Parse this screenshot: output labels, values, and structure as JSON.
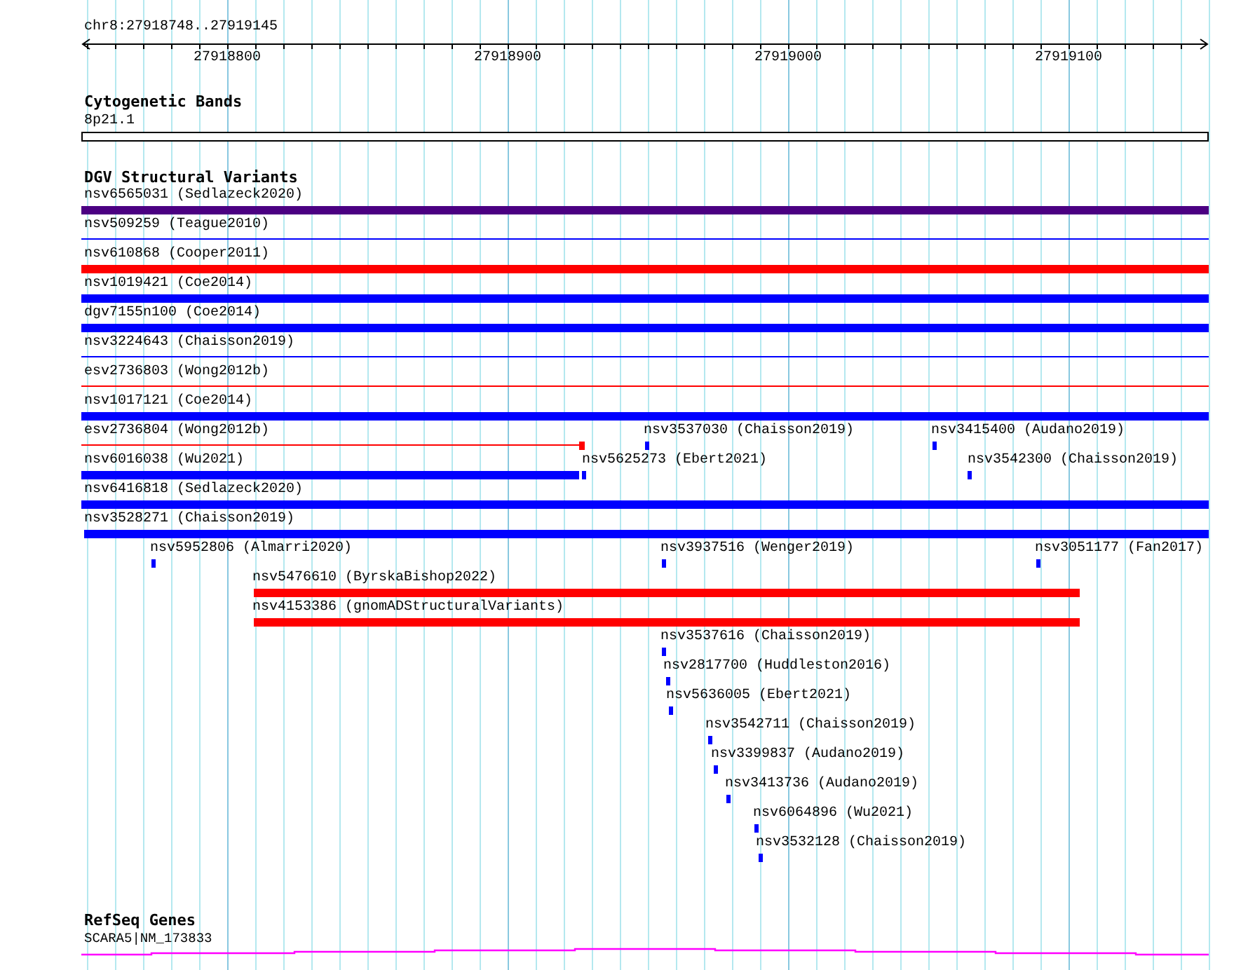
{
  "ruler": {
    "label": "chr8:27918748..27919145",
    "ticks": [
      "27918800",
      "27918900",
      "27919000",
      "27919100"
    ]
  },
  "cytogenetic_bands": {
    "title": "Cytogenetic Bands",
    "band": "8p21.1"
  },
  "dgv_structural_variants": {
    "title": "DGV Structural Variants",
    "features": [
      {
        "label": "nsv6565031 (Sedlazeck2020)",
        "color": "#4b0082",
        "kind": "thick"
      },
      {
        "label": "nsv509259 (Teague2010)",
        "color": "#0000ff",
        "kind": "thin"
      },
      {
        "label": "nsv610868 (Cooper2011)",
        "color": "#ff0000",
        "kind": "thick"
      },
      {
        "label": "nsv1019421 (Coe2014)",
        "color": "#0000ff",
        "kind": "thick"
      },
      {
        "label": "dgv7155n100 (Coe2014)",
        "color": "#0000ff",
        "kind": "thick"
      },
      {
        "label": "nsv3224643 (Chaisson2019)",
        "color": "#0000ff",
        "kind": "thin"
      },
      {
        "label": "esv2736803 (Wong2012b)",
        "color": "#ff0000",
        "kind": "thin"
      },
      {
        "label": "nsv1017121 (Coe2014)",
        "color": "#0000ff",
        "kind": "thick"
      },
      {
        "label": "esv2736804 (Wong2012b)",
        "color": "#ff0000",
        "kind": "capped"
      },
      {
        "label": "nsv3537030 (Chaisson2019)",
        "color": "#0000ff",
        "kind": "thick"
      },
      {
        "label": "nsv3415400 (Audano2019)",
        "color": "#0000ff",
        "kind": "thick"
      },
      {
        "label": "nsv6016038 (Wu2021)",
        "color": "#0000ff",
        "kind": "thick"
      },
      {
        "label": "nsv5625273 (Ebert2021)",
        "color": "#0000ff",
        "kind": "thick"
      },
      {
        "label": "nsv3542300 (Chaisson2019)",
        "color": "#0000ff",
        "kind": "thick"
      },
      {
        "label": "nsv6416818 (Sedlazeck2020)",
        "color": "#0000ff",
        "kind": "thick"
      },
      {
        "label": "nsv3528271 (Chaisson2019)",
        "color": "#0000ff",
        "kind": "thick"
      },
      {
        "label": "nsv5952806 (Almarri2020)",
        "color": "#0000ff",
        "kind": "thick"
      },
      {
        "label": "nsv3937516 (Wenger2019)",
        "color": "#0000ff",
        "kind": "thick"
      },
      {
        "label": "nsv3051177 (Fan2017)",
        "color": "#0000ff",
        "kind": "thick"
      },
      {
        "label": "nsv5476610 (ByrskaBishop2022)",
        "color": "#ff0000",
        "kind": "thick"
      },
      {
        "label": "nsv4153386 (gnomADStructuralVariants)",
        "color": "#ff0000",
        "kind": "thick"
      },
      {
        "label": "nsv3537616 (Chaisson2019)",
        "color": "#0000ff",
        "kind": "thick"
      },
      {
        "label": "nsv2817700 (Huddleston2016)",
        "color": "#0000ff",
        "kind": "thick"
      },
      {
        "label": "nsv5636005 (Ebert2021)",
        "color": "#0000ff",
        "kind": "thick"
      },
      {
        "label": "nsv3542711 (Chaisson2019)",
        "color": "#0000ff",
        "kind": "thick"
      },
      {
        "label": "nsv3399837 (Audano2019)",
        "color": "#0000ff",
        "kind": "thick"
      },
      {
        "label": "nsv3413736 (Audano2019)",
        "color": "#0000ff",
        "kind": "thick"
      },
      {
        "label": "nsv6064896 (Wu2021)",
        "color": "#0000ff",
        "kind": "thick"
      },
      {
        "label": "nsv3532128 (Chaisson2019)",
        "color": "#0000ff",
        "kind": "thick"
      }
    ]
  },
  "refseq_genes": {
    "title": "RefSeq Genes",
    "gene": "SCARA5|NM_173833"
  }
}
